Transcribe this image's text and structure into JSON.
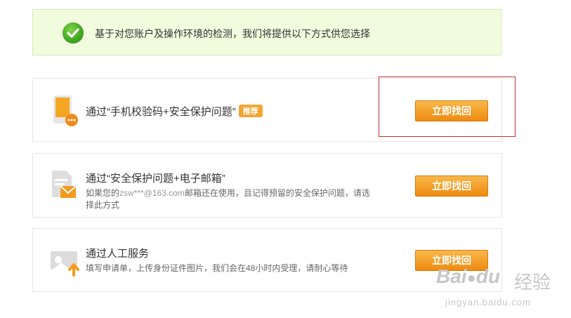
{
  "notice": {
    "text": "基于对您账户及操作环境的检测，我们将提供以下方式供您选择"
  },
  "options": [
    {
      "title": "通过“手机校验码+安全保护问题”",
      "badge": "推荐",
      "button": "立即找回"
    },
    {
      "title": "通过“安全保护问题+电子邮箱”",
      "desc_prefix": "如果您的",
      "email": "zsw***@163.com",
      "desc_suffix": "邮箱还在使用，且记得预留的安全保护问题，请选择此方式",
      "button": "立即找回"
    },
    {
      "title": "通过人工服务",
      "desc": "填写申请单，上传身份证件图片，我们会在48小时内受理，请耐心等待",
      "button": "立即找回"
    }
  ],
  "watermark": {
    "brand": "Bai",
    "brand2": "du",
    "cn": "经验",
    "url": "jingyan.baidu.com"
  },
  "colors": {
    "accent": "#ee8a10",
    "notice_bg": "#f1fbdd",
    "highlight": "#cc2a2a"
  }
}
